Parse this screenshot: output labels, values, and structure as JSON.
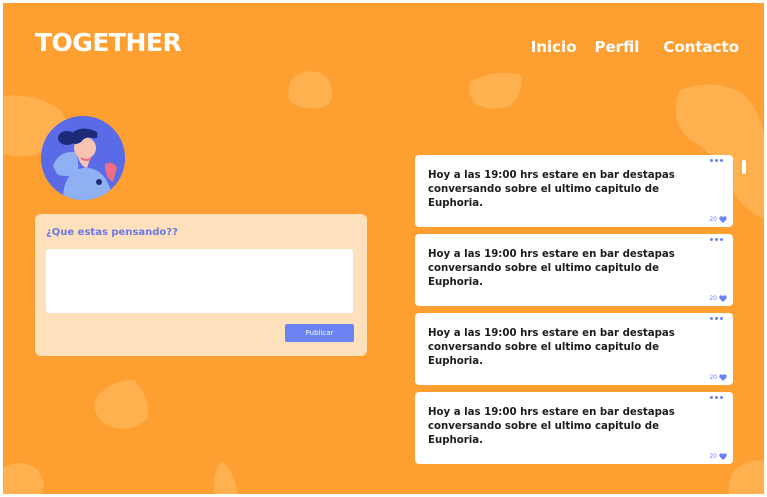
{
  "header": {
    "logo": "TOGETHER",
    "nav": [
      "Inicio",
      "Perfil",
      "Contacto"
    ]
  },
  "composer": {
    "label": "¿Que estas pensando??",
    "input_value": "",
    "publish_label": "Publicar"
  },
  "feed": {
    "posts": [
      {
        "text": "Hoy a las 19:00 hrs estare en bar destapas conversando sobre el ultimo capitulo de Euphoria.",
        "likes": "20"
      },
      {
        "text": "Hoy a las 19:00 hrs estare en bar destapas conversando sobre el ultimo capitulo de Euphoria.",
        "likes": "20"
      },
      {
        "text": "Hoy a las 19:00 hrs estare en bar destapas conversando sobre el ultimo capitulo de Euphoria.",
        "likes": "20"
      },
      {
        "text": "Hoy a las 19:00 hrs estare en bar destapas conversando sobre el ultimo capitulo de Euphoria.",
        "likes": "20"
      }
    ]
  },
  "icons": {
    "post_menu": "more-dots-icon",
    "like": "heart-icon",
    "avatar": "user-illustration"
  },
  "colors": {
    "background": "#fe9f31",
    "accent": "#6b82f5",
    "composer_bg": "#fde1bd",
    "card_bg": "#ffffff"
  }
}
